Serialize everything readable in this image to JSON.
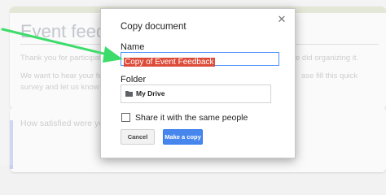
{
  "background_form": {
    "title": "Event feedb",
    "desc_line1_left": "Thank you for participati",
    "desc_line1_right": "e did organizing it.",
    "desc_line2_left": "We want to hear your feedb",
    "desc_line2_right": "ase fill this quick",
    "desc_line3_left": "survey and let us know w",
    "question": "How satisfied were you"
  },
  "dialog": {
    "title": "Copy document",
    "close_icon": "close-icon",
    "name_label": "Name",
    "name_value": "Copy of Event Feedback",
    "folder_label": "Folder",
    "folder_icon": "folder-icon",
    "folder_value": "My Drive",
    "share_label": "Share it with the same people",
    "share_checked": false,
    "cancel_label": "Cancel",
    "make_copy_label": "Make a copy"
  },
  "colors": {
    "selection": "#dd4b39",
    "primary_button": "#4787ed",
    "focus_border": "#4d90fe",
    "annotation_arrow": "#3ddc6a"
  }
}
